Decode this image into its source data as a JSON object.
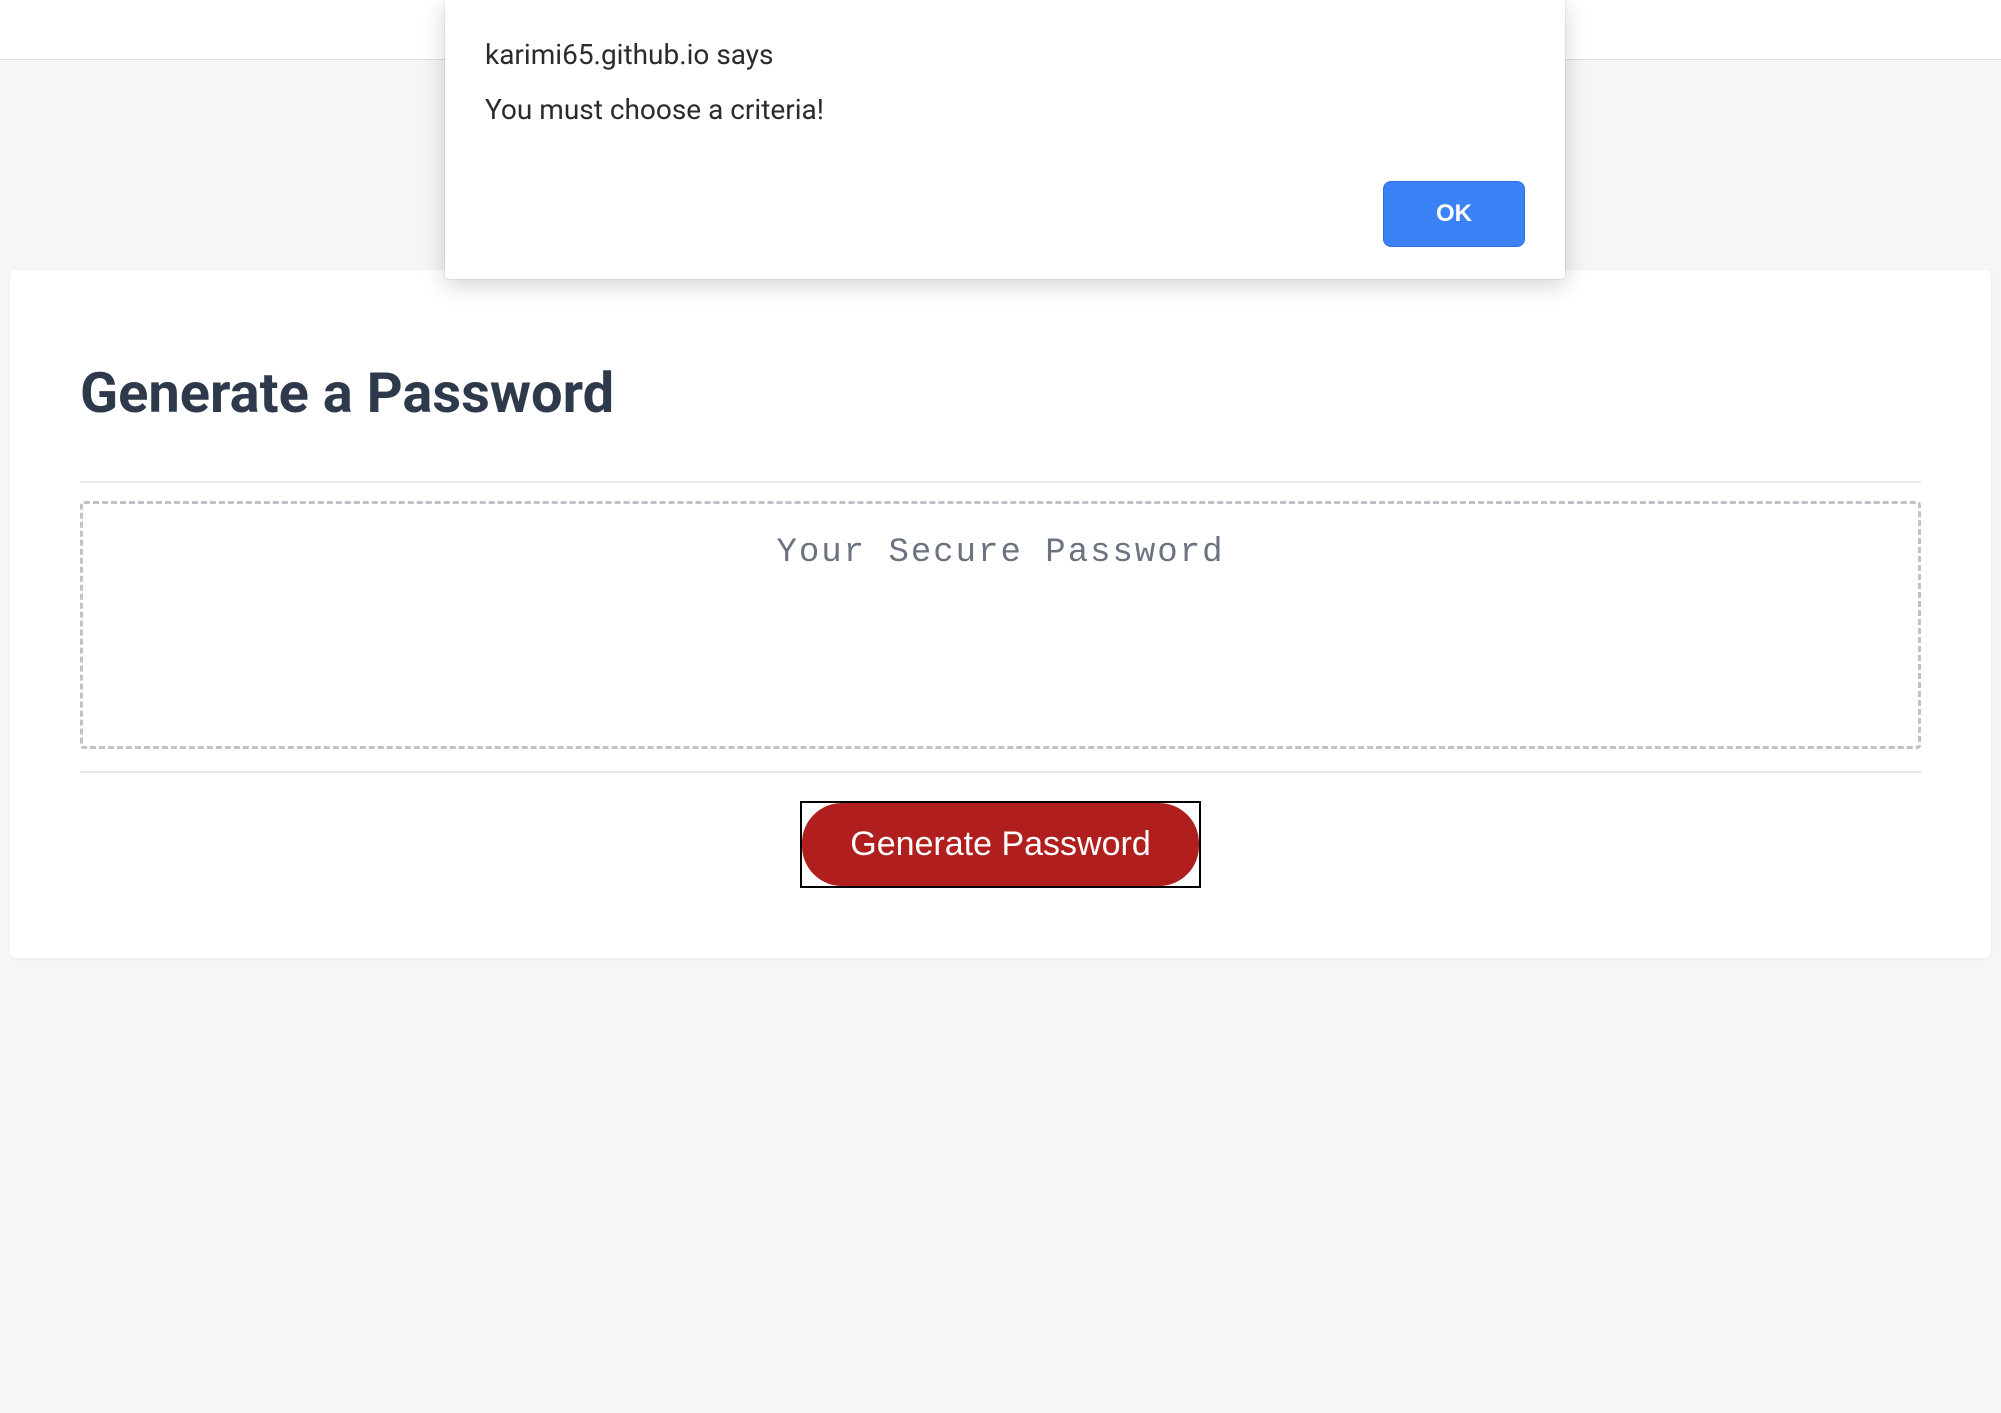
{
  "alert": {
    "origin_text": "karimi65.github.io says",
    "message": "You must choose a criteria!",
    "ok_label": "OK"
  },
  "card": {
    "title": "Generate a Password",
    "placeholder": "Your Secure Password",
    "button_label": "Generate Password"
  }
}
